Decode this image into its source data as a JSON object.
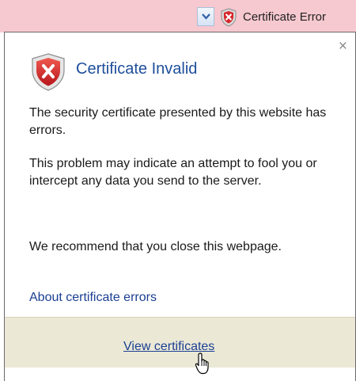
{
  "address_bar": {
    "dropdown_icon": "chevron-down-icon",
    "status_icon": "shield-error-icon",
    "status_label": "Certificate Error",
    "background_color": "#f6c8cf"
  },
  "popup": {
    "close_label": "×",
    "title_icon": "shield-error-icon",
    "title": "Certificate Invalid",
    "paragraphs": [
      "The security certificate presented by this website has errors.",
      "This problem may indicate an attempt to fool you or intercept any data you send to the server.",
      "We recommend that you close this webpage."
    ],
    "about_link": "About certificate errors",
    "footer_link": "View certificates",
    "cursor_icon": "hand-pointer-icon",
    "accent_color": "#1e4e9b",
    "footer_color": "#ebe9d6"
  }
}
